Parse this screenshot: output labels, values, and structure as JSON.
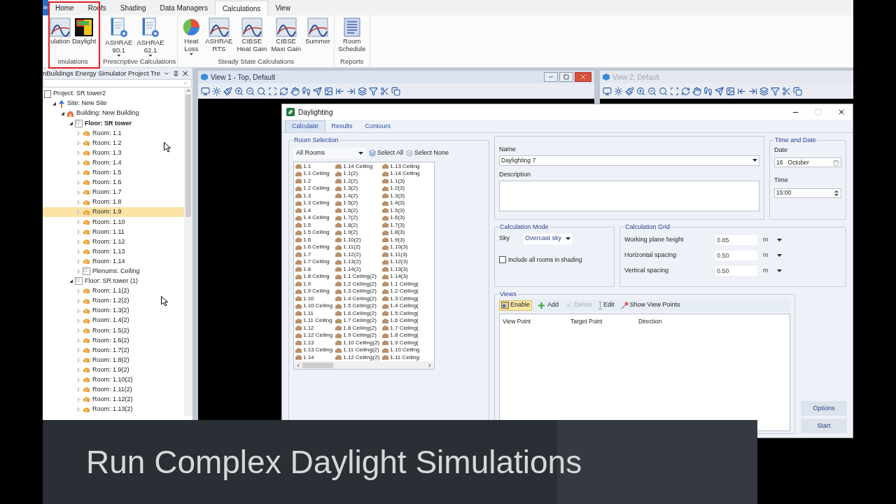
{
  "ribbon": {
    "app_tab": "le",
    "tabs": [
      {
        "label": "Home",
        "selected": false
      },
      {
        "label": "Roofs",
        "selected": false
      },
      {
        "label": "Shading",
        "selected": false
      },
      {
        "label": "Data Managers",
        "selected": false
      },
      {
        "label": "Calculations",
        "selected": true
      },
      {
        "label": "View",
        "selected": false
      }
    ],
    "groups": [
      {
        "label": "imulations",
        "buttons": [
          {
            "label": "ulation",
            "kind": "chart",
            "dropdown": false
          },
          {
            "label": "Daylight",
            "kind": "heatmap",
            "dropdown": false
          }
        ]
      },
      {
        "label": "Prescriptive Calculations",
        "buttons": [
          {
            "label": "ASHRAE\n90.1",
            "kind": "document",
            "dropdown": true
          },
          {
            "label": "ASHRAE\n62.1",
            "kind": "document",
            "dropdown": true
          }
        ]
      },
      {
        "label": "Steady State Calculations",
        "buttons": [
          {
            "label": "Heat\nLoss",
            "kind": "pie",
            "dropdown": true
          },
          {
            "label": "ASHRAE\nRTS",
            "kind": "chart",
            "dropdown": false
          },
          {
            "label": "CIBSE\nHeat Gain",
            "kind": "chart",
            "dropdown": false
          },
          {
            "label": "CIBSE\nMaxi Gain",
            "kind": "chart",
            "dropdown": false
          },
          {
            "label": "Summer",
            "kind": "chart",
            "dropdown": false
          }
        ]
      },
      {
        "label": "Reports",
        "buttons": [
          {
            "label": "Room\nSchedule",
            "kind": "report",
            "dropdown": false
          }
        ]
      }
    ]
  },
  "project_tree": {
    "title": "nBuildings Energy Simulator Project Tre",
    "nodes": [
      {
        "label": "Project: SR tower2",
        "kind": "project",
        "selected": false,
        "children": [
          {
            "label": "Site: New Site",
            "kind": "site",
            "expanded": true,
            "selected": false,
            "children": [
              {
                "label": "Building: New Building",
                "kind": "building",
                "expanded": true,
                "selected": false,
                "children": [
                  {
                    "label": "Floor: SR tower",
                    "kind": "floor",
                    "active": true,
                    "expanded": true,
                    "selected": false,
                    "children": [
                      {
                        "label": "Room: 1.1",
                        "kind": "room",
                        "expanded": false,
                        "selected": false
                      },
                      {
                        "label": "Room: 1.2",
                        "kind": "room",
                        "expanded": false,
                        "selected": false
                      },
                      {
                        "label": "Room: 1.3",
                        "kind": "room",
                        "expanded": false,
                        "selected": false
                      },
                      {
                        "label": "Room: 1.4",
                        "kind": "room",
                        "expanded": false,
                        "selected": false
                      },
                      {
                        "label": "Room: 1.5",
                        "kind": "room",
                        "expanded": false,
                        "selected": false
                      },
                      {
                        "label": "Room: 1.6",
                        "kind": "room",
                        "expanded": false,
                        "selected": false
                      },
                      {
                        "label": "Room: 1.7",
                        "kind": "room",
                        "expanded": false,
                        "selected": false
                      },
                      {
                        "label": "Room: 1.8",
                        "kind": "room",
                        "expanded": false,
                        "selected": false
                      },
                      {
                        "label": "Room: 1.9",
                        "kind": "room",
                        "expanded": false,
                        "selected": true
                      },
                      {
                        "label": "Room: 1.10",
                        "kind": "room",
                        "expanded": false,
                        "selected": false
                      },
                      {
                        "label": "Room: 1.11",
                        "kind": "room",
                        "expanded": false,
                        "selected": false
                      },
                      {
                        "label": "Room: 1.12",
                        "kind": "room",
                        "expanded": false,
                        "selected": false
                      },
                      {
                        "label": "Room: 1.13",
                        "kind": "room",
                        "expanded": false,
                        "selected": false
                      },
                      {
                        "label": "Room: 1.14",
                        "kind": "room",
                        "expanded": false,
                        "selected": false
                      },
                      {
                        "label": "Plenums: Ceiling",
                        "kind": "plenum",
                        "expanded": false,
                        "selected": false
                      }
                    ]
                  },
                  {
                    "label": "Floor: SR tower (1)",
                    "kind": "floor",
                    "active": false,
                    "expanded": true,
                    "selected": false,
                    "children": [
                      {
                        "label": "Room: 1.1(2)",
                        "kind": "room",
                        "expanded": false,
                        "selected": false
                      },
                      {
                        "label": "Room: 1.2(2)",
                        "kind": "room",
                        "expanded": false,
                        "selected": false
                      },
                      {
                        "label": "Room: 1.3(2)",
                        "kind": "room",
                        "expanded": false,
                        "selected": false
                      },
                      {
                        "label": "Room: 1.4(2)",
                        "kind": "room",
                        "expanded": false,
                        "selected": false
                      },
                      {
                        "label": "Room: 1.5(2)",
                        "kind": "room",
                        "expanded": false,
                        "selected": false
                      },
                      {
                        "label": "Room: 1.6(2)",
                        "kind": "room",
                        "expanded": false,
                        "selected": false
                      },
                      {
                        "label": "Room: 1.7(2)",
                        "kind": "room",
                        "expanded": false,
                        "selected": false
                      },
                      {
                        "label": "Room: 1.8(2)",
                        "kind": "room",
                        "expanded": false,
                        "selected": false
                      },
                      {
                        "label": "Room: 1.9(2)",
                        "kind": "room",
                        "expanded": false,
                        "selected": false
                      },
                      {
                        "label": "Room: 1.10(2)",
                        "kind": "room",
                        "expanded": false,
                        "selected": false
                      },
                      {
                        "label": "Room: 1.11(2)",
                        "kind": "room",
                        "expanded": false,
                        "selected": false
                      },
                      {
                        "label": "Room: 1.12(2)",
                        "kind": "room",
                        "expanded": false,
                        "selected": false
                      },
                      {
                        "label": "Room: 1.13(2)",
                        "kind": "room",
                        "expanded": false,
                        "selected": false
                      }
                    ]
                  }
                ]
              }
            ]
          }
        ]
      }
    ]
  },
  "views": [
    {
      "title": "View 1 - Top, Default",
      "active": true
    },
    {
      "title": "View 2, Default",
      "active": false
    }
  ],
  "dialog": {
    "title": "Daylighting",
    "tabs": [
      {
        "label": "Calculate",
        "selected": true
      },
      {
        "label": "Results",
        "selected": false
      },
      {
        "label": "Contours",
        "selected": false
      }
    ],
    "room_selection": {
      "title": "Room Selection",
      "filter": "All Rooms",
      "select_all": "Select All",
      "select_none": "Select None",
      "rooms": [
        "1.1",
        "1.1 Ceiling",
        "1.2",
        "1.2 Ceiling",
        "1.3",
        "1.3 Ceiling",
        "1.4",
        "1.4 Ceiling",
        "1.5",
        "1.5 Ceiling",
        "1.6",
        "1.6 Ceiling",
        "1.7",
        "1.7 Ceiling",
        "1.8",
        "1.8 Ceiling",
        "1.9",
        "1.9 Ceiling",
        "1.10",
        "1.10 Ceiling",
        "1.11",
        "1.11 Ceiling",
        "1.12",
        "1.12 Ceiling",
        "1.13",
        "1.13 Ceiling",
        "1.14",
        "1.14 Ceiling",
        "1.1(2)",
        "1.2(2)",
        "1.3(2)",
        "1.4(2)",
        "1.5(2)",
        "1.6(2)",
        "1.7(2)",
        "1.8(2)",
        "1.9(2)",
        "1.10(2)",
        "1.11(2)",
        "1.12(2)",
        "1.13(2)",
        "1.14(2)",
        "1.1 Ceiling(2)",
        "1.2 Ceiling(2)",
        "1.3 Ceiling(2)",
        "1.4 Ceiling(2)",
        "1.5 Ceiling(2)",
        "1.6 Ceiling(2)",
        "1.7 Ceiling(2)",
        "1.8 Ceiling(2)",
        "1.9 Ceiling(2)",
        "1.10 Ceiling(2)",
        "1.11 Ceiling(2)",
        "1.12 Ceiling(2)",
        "1.13 Ceiling",
        "1.14 Ceiling",
        "1.1(3)",
        "1.2(3)",
        "1.3(3)",
        "1.4(3)",
        "1.5(3)",
        "1.6(3)",
        "1.7(3)",
        "1.8(3)",
        "1.9(3)",
        "1.10(3)",
        "1.11(3)",
        "1.12(3)",
        "1.13(3)",
        "1.14(3)",
        "1.1 Ceiling(",
        "1.2 Ceiling(",
        "1.3 Ceiling(",
        "1.4 Ceiling(",
        "1.5 Ceiling(",
        "1.6 Ceiling(",
        "1.7 Ceiling(",
        "1.8 Ceiling(",
        "1.9 Ceiling(",
        "1.10 Ceiling",
        "1.11 Ceiling"
      ]
    },
    "name": {
      "label": "Name",
      "value": "Daylighting 7"
    },
    "description": {
      "label": "Description"
    },
    "time_and_date": {
      "title": "Time and Date",
      "date_label": "Date",
      "date": "16   October",
      "time_label": "Time",
      "time": "15:00"
    },
    "calculation_mode": {
      "title": "Calculation Mode",
      "sky_label": "Sky",
      "sky": "Overcast sky",
      "include_all_rooms": {
        "label": "Include all rooms in shading",
        "checked": false
      }
    },
    "calculation_grid": {
      "title": "Calculation Grid",
      "rows": [
        {
          "label": "Working plane height",
          "value": "0.85",
          "unit": "m"
        },
        {
          "label": "Horizontal spacing",
          "value": "0.50",
          "unit": "m"
        },
        {
          "label": "Vertical spacing",
          "value": "0.50",
          "unit": "m"
        }
      ]
    },
    "views": {
      "title": "Views",
      "tools": [
        {
          "label": "Enable",
          "kind": "enable",
          "on": true,
          "disabled": false
        },
        {
          "label": "Add",
          "kind": "add",
          "on": false,
          "disabled": false
        },
        {
          "label": "Delete",
          "kind": "delete",
          "on": false,
          "disabled": true
        },
        {
          "label": "Edit",
          "kind": "edit",
          "on": false,
          "disabled": false
        },
        {
          "label": "Show View Points",
          "kind": "points",
          "on": false,
          "disabled": false
        }
      ],
      "columns": [
        "View Point",
        "Target Point",
        "Direction"
      ]
    },
    "buttons": [
      "Options",
      "Start"
    ]
  },
  "caption": "Run Complex Daylight Simulations"
}
